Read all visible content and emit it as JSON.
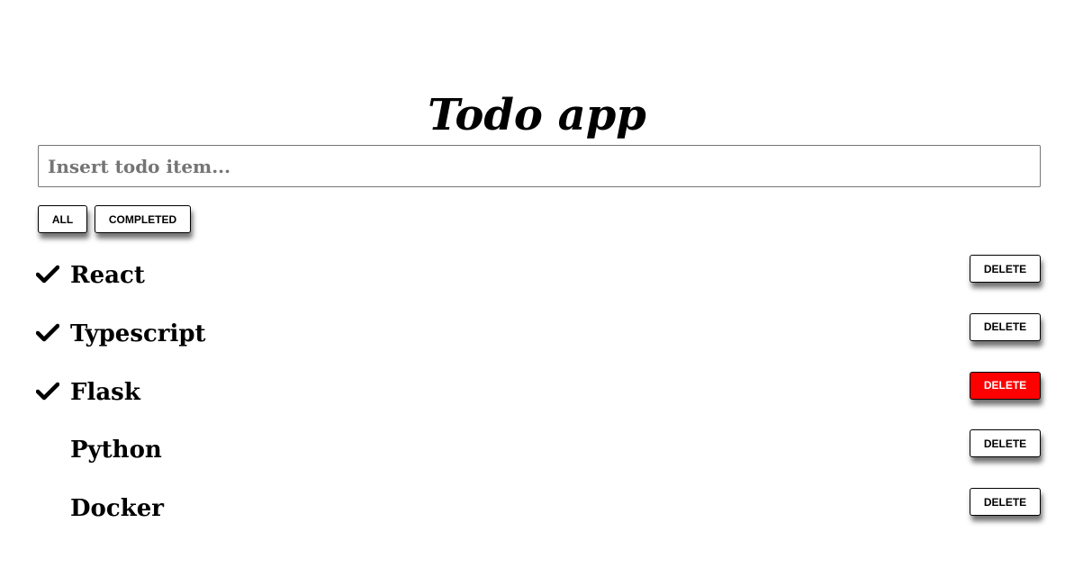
{
  "app": {
    "title": "Todo app"
  },
  "input": {
    "placeholder": "Insert todo item...",
    "value": ""
  },
  "filters": {
    "all_label": "ALL",
    "completed_label": "COMPLETED"
  },
  "todos": [
    {
      "text": "React",
      "completed": true,
      "delete_label": "DELETE"
    },
    {
      "text": "Typescript",
      "completed": true,
      "delete_label": "DELETE"
    },
    {
      "text": "Flask",
      "completed": true,
      "delete_label": "DELETE"
    },
    {
      "text": "Python",
      "completed": false,
      "delete_label": "DELETE"
    },
    {
      "text": "Docker",
      "completed": false,
      "delete_label": "DELETE"
    }
  ],
  "icons": {
    "completed_marker": "check-icon"
  },
  "colors": {
    "delete_hover": "#ff0000",
    "delete_hover_text": "#ffffff"
  }
}
